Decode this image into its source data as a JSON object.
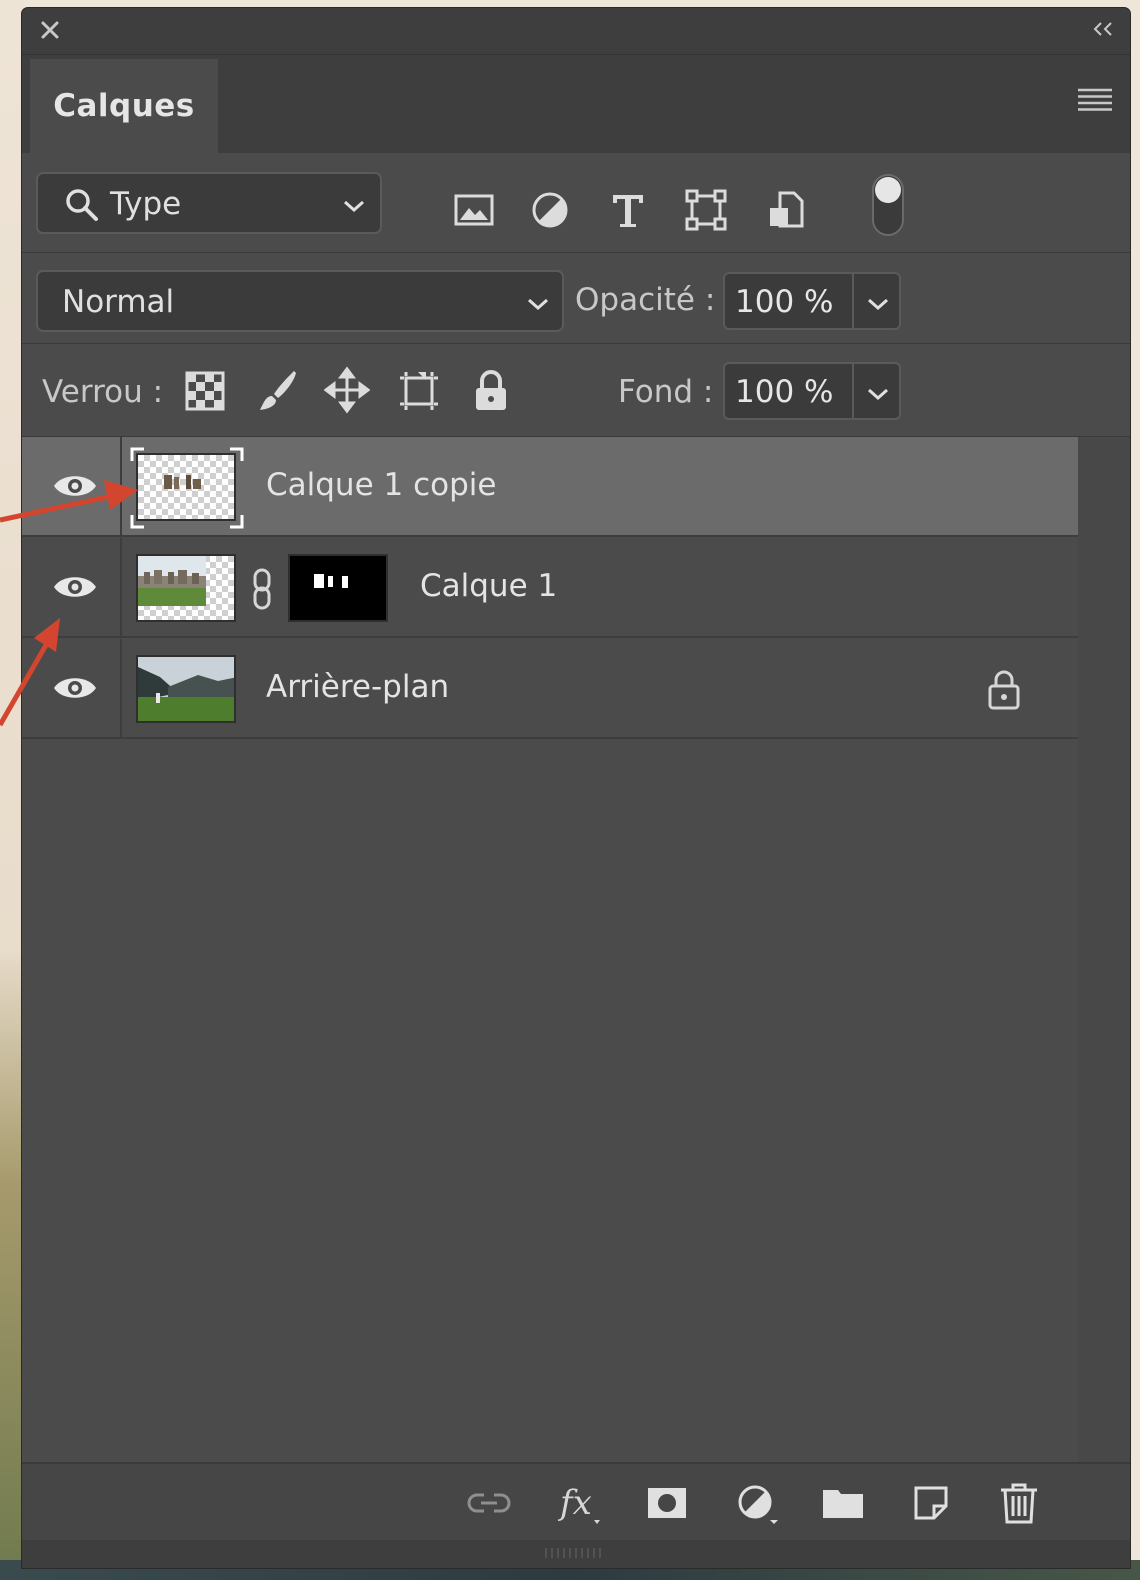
{
  "panel": {
    "tab_label": "Calques",
    "icons": {
      "close": "close-icon",
      "collapse": "double-chevron-left-icon",
      "menu": "panel-menu-icon"
    }
  },
  "filter": {
    "kind_value": "Type",
    "kind_icon": "search-icon",
    "filter_icons": [
      "pixel-layer-filter-icon",
      "adjustment-layer-filter-icon",
      "type-layer-filter-icon",
      "shape-layer-filter-icon",
      "smart-object-filter-icon"
    ],
    "toggle_state": "on"
  },
  "blend": {
    "mode": "Normal",
    "opacity_label": "Opacité :",
    "opacity_value": "100 %"
  },
  "lock": {
    "label": "Verrou :",
    "lock_icons": [
      "lock-transparent-pixels-icon",
      "lock-image-pixels-icon",
      "lock-position-icon",
      "lock-artboard-icon",
      "lock-all-icon"
    ],
    "fill_label": "Fond :",
    "fill_value": "100 %"
  },
  "layers": [
    {
      "name": "Calque 1 copie",
      "visible": true,
      "selected": true,
      "thumbnail": "transparent-with-stones",
      "locked": false
    },
    {
      "name": "Calque 1",
      "visible": true,
      "selected": false,
      "thumbnail": "stonehenge-masked",
      "mask": "black-mask-white-stones",
      "linked": true,
      "locked": false
    },
    {
      "name": "Arrière-plan",
      "visible": true,
      "selected": false,
      "thumbnail": "mountain-landscape",
      "locked": true
    }
  ],
  "bottom_toolbar": [
    "link-layers-icon",
    "fx-icon",
    "add-mask-icon",
    "new-adjustment-icon",
    "new-group-folder-icon",
    "new-layer-icon",
    "trash-icon"
  ],
  "colors": {
    "panel_bg": "#4b4b4b",
    "selected_row": "#6b6b6b",
    "annotation_arrow": "#d4452f"
  }
}
